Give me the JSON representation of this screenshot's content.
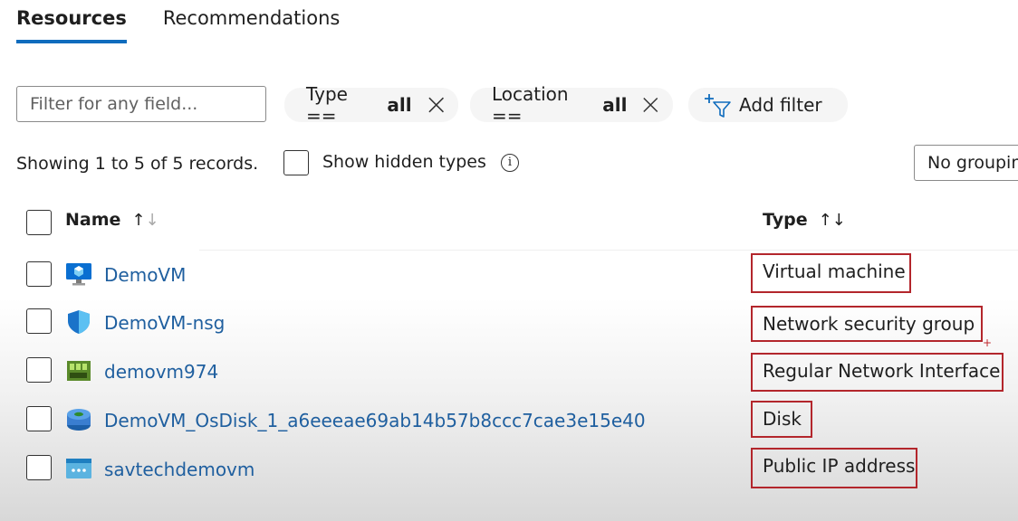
{
  "tabs": [
    {
      "label": "Resources",
      "active": true
    },
    {
      "label": "Recommendations",
      "active": false
    }
  ],
  "filter": {
    "placeholder": "Filter for any field..."
  },
  "pills": {
    "type_label": "Type ==",
    "type_value": "all",
    "location_label": "Location ==",
    "location_value": "all",
    "add_filter": "Add filter"
  },
  "summary": {
    "showing_text": "Showing 1 to 5 of 5 records.",
    "show_hidden_label": "Show hidden types",
    "info_glyph": "i",
    "grouping_value": "No grouping"
  },
  "table": {
    "columns": {
      "name": "Name",
      "type": "Type"
    },
    "sort_name": {
      "up": "↑",
      "down": "↓"
    },
    "sort_type": "↑↓",
    "rows": [
      {
        "name": "DemoVM",
        "type": "Virtual machine",
        "icon": "virtual-machine-icon"
      },
      {
        "name": "DemoVM-nsg",
        "type": "Network security group",
        "icon": "shield-icon"
      },
      {
        "name": "demovm974",
        "type": "Regular Network Interface",
        "icon": "network-interface-icon"
      },
      {
        "name": "DemoVM_OsDisk_1_a6eeeae69ab14b57b8ccc7cae3e15e40",
        "type": "Disk",
        "icon": "disk-icon"
      },
      {
        "name": "savtechdemovm",
        "type": "Public IP address",
        "icon": "public-ip-icon"
      }
    ]
  },
  "annotation": {
    "plus": "+"
  },
  "colors": {
    "accent": "#0f6cbd",
    "link": "#1f5f9f",
    "highlight_box": "#b3262c"
  }
}
